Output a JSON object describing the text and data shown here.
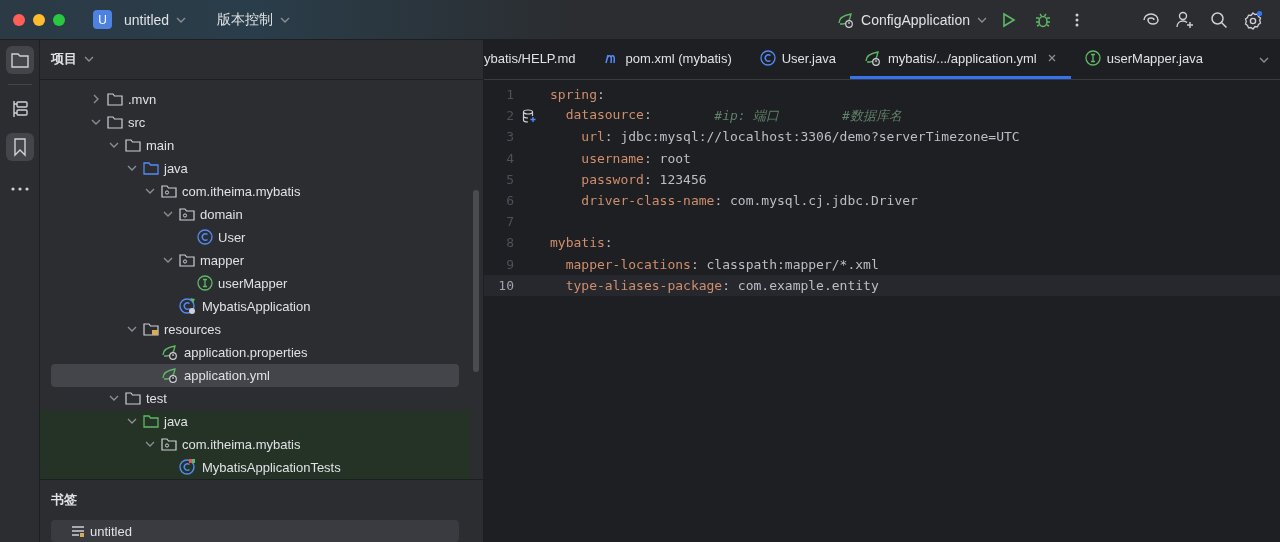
{
  "title_bar": {
    "project_badge": "U",
    "project": "untitled",
    "vcs": "版本控制",
    "run_config": "ConfigApplication"
  },
  "tool_strip": [
    {
      "kind": "project",
      "selected": true
    },
    {
      "kind": "structure",
      "selected": false
    },
    {
      "kind": "bookmarks",
      "selected": true
    },
    {
      "kind": "more",
      "selected": false
    }
  ],
  "project_panel": {
    "title": "项目",
    "tree": [
      {
        "label": ".mvn",
        "kind": "folder",
        "expanded": false,
        "selected": false
      },
      {
        "label": "src",
        "kind": "folder",
        "expanded": true,
        "selected": false,
        "children": [
          {
            "label": "main",
            "kind": "folder",
            "expanded": true,
            "selected": false,
            "children": [
              {
                "label": "java",
                "kind": "source-folder",
                "expanded": true,
                "selected": false,
                "children": [
                  {
                    "label": "com.itheima.mybatis",
                    "kind": "package",
                    "expanded": true,
                    "selected": false,
                    "children": [
                      {
                        "label": "domain",
                        "kind": "package",
                        "expanded": true,
                        "selected": false,
                        "children": [
                          {
                            "label": "User",
                            "kind": "class",
                            "selected": false
                          }
                        ]
                      },
                      {
                        "label": "mapper",
                        "kind": "package",
                        "expanded": true,
                        "selected": false,
                        "children": [
                          {
                            "label": "userMapper",
                            "kind": "interface",
                            "selected": false
                          }
                        ]
                      },
                      {
                        "label": "MybatisApplication",
                        "kind": "spring-class",
                        "selected": false
                      }
                    ]
                  }
                ]
              },
              {
                "label": "resources",
                "kind": "resources",
                "expanded": true,
                "selected": false,
                "children": [
                  {
                    "label": "application.properties",
                    "kind": "spring-config",
                    "selected": false
                  },
                  {
                    "label": "application.yml",
                    "kind": "spring-config",
                    "selected": true
                  }
                ]
              }
            ]
          },
          {
            "label": "test",
            "kind": "folder",
            "expanded": true,
            "selected": false,
            "children": [
              {
                "label": "java",
                "kind": "test-folder",
                "expanded": true,
                "selected": false,
                "children": [
                  {
                    "label": "com.itheima.mybatis",
                    "kind": "package",
                    "expanded": true,
                    "selected": false,
                    "children": [
                      {
                        "label": "MybatisApplicationTests",
                        "kind": "test-class",
                        "selected": false
                      }
                    ]
                  }
                ]
              }
            ]
          }
        ]
      }
    ]
  },
  "bookmarks": {
    "title": "书签",
    "items": [
      {
        "label": "untitled",
        "selected": true
      }
    ]
  },
  "tabs": [
    {
      "label": "ybatis/HELP.md",
      "kind": "markdown",
      "selected": false
    },
    {
      "label": "pom.xml (mybatis)",
      "kind": "maven",
      "selected": false
    },
    {
      "label": "User.java",
      "kind": "class",
      "selected": false
    },
    {
      "label": "mybatis/.../application.yml",
      "kind": "spring-config",
      "selected": true
    },
    {
      "label": "userMapper.java",
      "kind": "interface",
      "selected": false
    }
  ],
  "editor": {
    "lines": [
      {
        "number": "1",
        "current": false,
        "segments": [
          {
            "kind": "key",
            "text": "spring"
          },
          {
            "kind": "plain",
            "text": ":"
          }
        ]
      },
      {
        "number": "2",
        "current": false,
        "gutter_icon": {
          "kind": "database"
        },
        "segments": [
          {
            "kind": "key",
            "text": "  datasource"
          },
          {
            "kind": "plain",
            "text": ":"
          },
          {
            "kind": "comment",
            "text": "#ip: 端口"
          },
          {
            "kind": "comment",
            "text": "#数据库名"
          }
        ]
      },
      {
        "number": "3",
        "current": false,
        "segments": [
          {
            "kind": "key",
            "text": "    url"
          },
          {
            "kind": "plain",
            "text": ": jdbc:mysql://localhost:3306/demo?serverTimezone=UTC"
          }
        ]
      },
      {
        "number": "4",
        "current": false,
        "segments": [
          {
            "kind": "key",
            "text": "    username"
          },
          {
            "kind": "plain",
            "text": ": root"
          }
        ]
      },
      {
        "number": "5",
        "current": false,
        "segments": [
          {
            "kind": "key",
            "text": "    password"
          },
          {
            "kind": "plain",
            "text": ": 123456"
          }
        ]
      },
      {
        "number": "6",
        "current": false,
        "segments": [
          {
            "kind": "key",
            "text": "    driver-class-name"
          },
          {
            "kind": "plain",
            "text": ": com.mysql.cj.jdbc.Driver"
          }
        ]
      },
      {
        "number": "7",
        "current": false
      },
      {
        "number": "8",
        "current": false,
        "segments": [
          {
            "kind": "key",
            "text": "mybatis"
          },
          {
            "kind": "plain",
            "text": ":"
          }
        ]
      },
      {
        "number": "9",
        "current": false,
        "segments": [
          {
            "kind": "key",
            "text": "  mapper-locations"
          },
          {
            "kind": "plain",
            "text": ": classpath:mapper/*.xml"
          }
        ]
      },
      {
        "number": "10",
        "current": true,
        "segments": [
          {
            "kind": "key",
            "text": "  type-aliases-package"
          },
          {
            "kind": "plain",
            "text": ": com.example.entity"
          }
        ]
      }
    ]
  }
}
